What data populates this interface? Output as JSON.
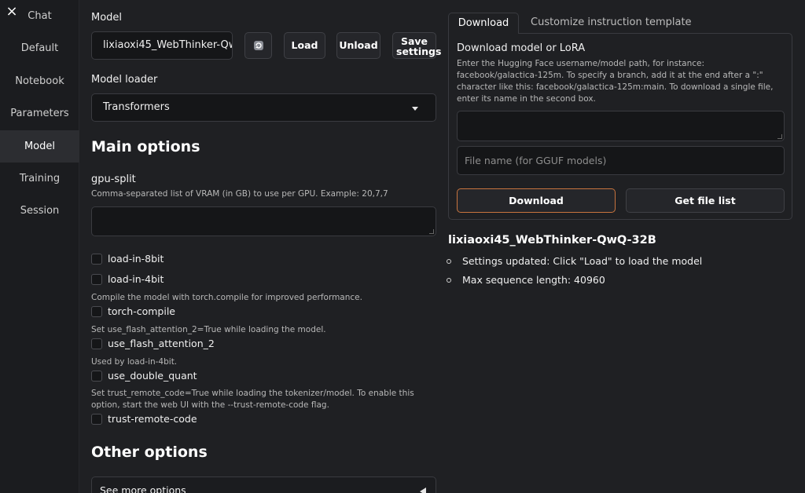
{
  "sidebar": {
    "close_icon": "×",
    "items": [
      {
        "label": "Chat"
      },
      {
        "label": "Default"
      },
      {
        "label": "Notebook"
      },
      {
        "label": "Parameters"
      },
      {
        "label": "Model"
      },
      {
        "label": "Training"
      },
      {
        "label": "Session"
      }
    ],
    "active_index": 4
  },
  "model": {
    "label": "Model",
    "value": "lixiaoxi45_WebThinker-QwQ-32B",
    "refresh_icon": "refresh-icon",
    "load_label": "Load",
    "unload_label": "Unload",
    "save_label": "Save settings"
  },
  "loader": {
    "label": "Model loader",
    "value": "Transformers"
  },
  "main_options": {
    "heading": "Main options",
    "gpu_split_label": "gpu-split",
    "gpu_split_hint": "Comma-separated list of VRAM (in GB) to use per GPU. Example: 20,7,7",
    "gpu_split_value": "",
    "checkboxes": {
      "load_in_8bit": "load-in-8bit",
      "load_in_4bit": "load-in-4bit",
      "torch_compile_hint": "Compile the model with torch.compile for improved performance.",
      "torch_compile": "torch-compile",
      "flash_hint": "Set use_flash_attention_2=True while loading the model.",
      "flash": "use_flash_attention_2",
      "double_quant_hint": "Used by load-in-4bit.",
      "double_quant": "use_double_quant",
      "trust_hint": "Set trust_remote_code=True while loading the tokenizer/model. To enable this option, start the web UI with the --trust-remote-code flag.",
      "trust": "trust-remote-code"
    }
  },
  "other_options": {
    "heading": "Other options",
    "see_more": "See more options"
  },
  "right": {
    "tabs": [
      {
        "label": "Download"
      },
      {
        "label": "Customize instruction template"
      }
    ],
    "download_title": "Download model or LoRA",
    "download_hint": "Enter the Hugging Face username/model path, for instance: facebook/galactica-125m. To specify a branch, add it at the end after a \":\" character like this: facebook/galactica-125m:main. To download a single file, enter its name in the second box.",
    "repo_value": "",
    "file_placeholder": "File name (for GGUF models)",
    "download_button": "Download",
    "file_list_button": "Get file list",
    "status_title": "lixiaoxi45_WebThinker-QwQ-32B",
    "status_items": [
      "Settings updated: Click \"Load\" to load the model",
      "Max sequence length: 40960"
    ]
  },
  "colors": {
    "accent": "#c8743e",
    "background": "#1f2023",
    "sidebar": "#1b1c1f",
    "input_bg": "#151618"
  }
}
